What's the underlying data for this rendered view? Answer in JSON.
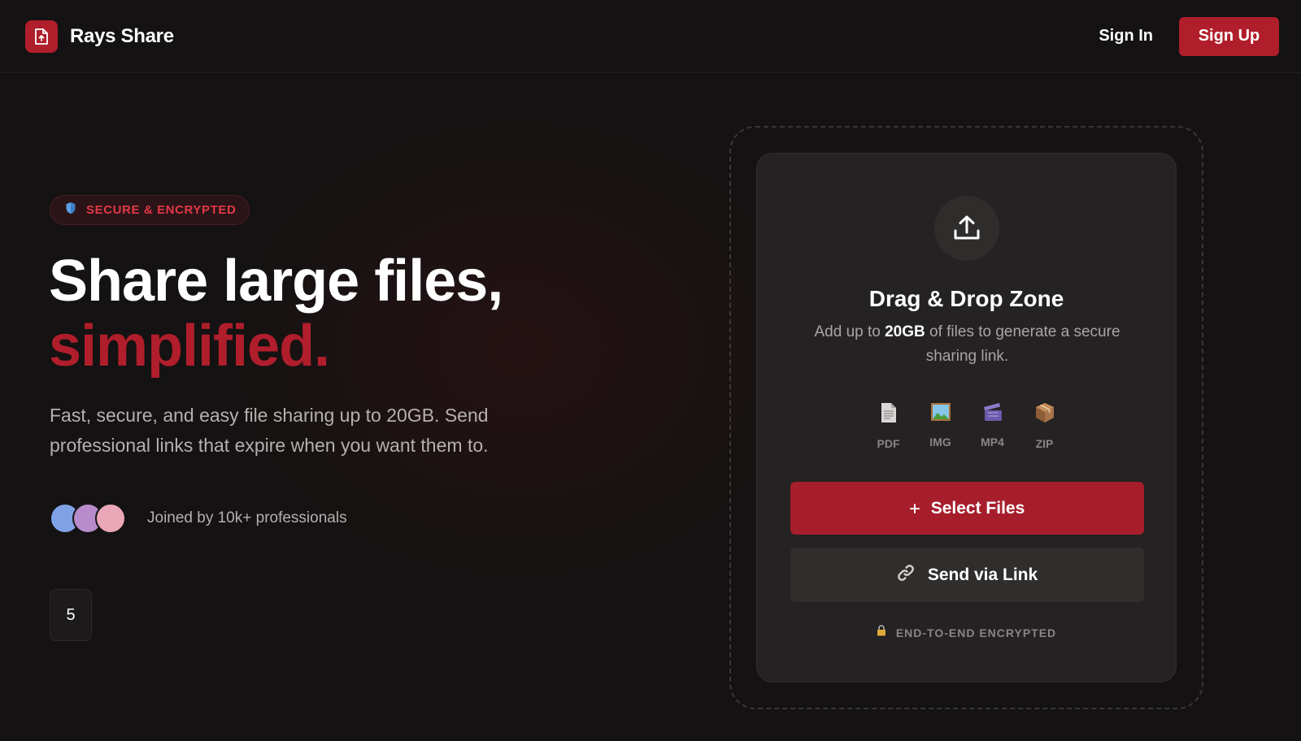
{
  "header": {
    "brand_name": "Rays Share",
    "logo_icon": "file-upload-icon",
    "sign_in_label": "Sign In",
    "sign_up_label": "Sign Up"
  },
  "hero": {
    "badge_icon": "shield-icon",
    "badge_text": "SECURE & ENCRYPTED",
    "headline_line1": "Share large files,",
    "headline_line2": "simplified.",
    "lead": "Fast, secure, and easy file sharing up to 20GB. Send professional links that expire when you want them to.",
    "social_proof": "Joined by 10k+ professionals",
    "avatar_colors": [
      "#7fa2e6",
      "#b88ccc",
      "#e9a7b8"
    ],
    "counter_value": "5"
  },
  "upload_card": {
    "upload_icon": "upload-icon",
    "title": "Drag & Drop Zone",
    "desc_prefix": "Add up to ",
    "desc_highlight": "20GB",
    "desc_suffix": " of files to generate a secure sharing link.",
    "file_types": [
      {
        "label": "PDF",
        "icon": "document-icon"
      },
      {
        "label": "IMG",
        "icon": "image-icon"
      },
      {
        "label": "MP4",
        "icon": "clapper-icon"
      },
      {
        "label": "ZIP",
        "icon": "package-icon"
      }
    ],
    "select_button": {
      "icon": "plus-icon",
      "label": "Select Files"
    },
    "link_button": {
      "icon": "link-icon",
      "label": "Send via Link"
    },
    "footer_icon": "lock-icon",
    "footer_text": "END-TO-END ENCRYPTED"
  },
  "colors": {
    "accent": "#b01e2b",
    "background": "#141212",
    "card": "#242222"
  }
}
